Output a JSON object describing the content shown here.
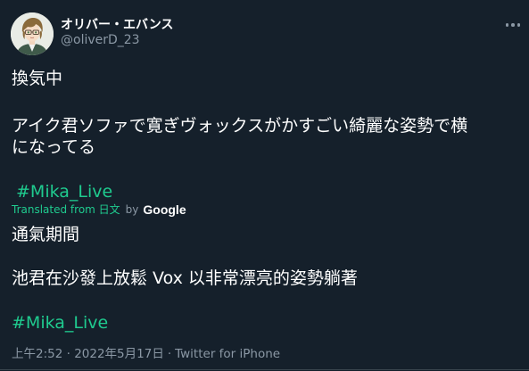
{
  "author": {
    "display_name": "オリバー・エバンス",
    "handle": "@oliverD_23"
  },
  "tweet": {
    "line1": "換気中",
    "line2": "アイク君ソファで寛ぎヴォックスがかすごい綺麗な姿勢で横",
    "line3": "になってる",
    "hashtag": "#Mika_Live"
  },
  "translation": {
    "translated_from": "Translated from 日文",
    "by": "by",
    "provider": "Google",
    "line1": "通氣期間",
    "line2": "池君在沙發上放鬆 Vox 以非常漂亮的姿勢躺著",
    "hashtag": "#Mika_Live"
  },
  "meta": {
    "timestamp": "上午2:52 · 2022年5月17日",
    "separator": "·",
    "source": "Twitter for iPhone"
  },
  "colors": {
    "background": "#15202b",
    "text": "#ffffff",
    "muted": "#8b98a5",
    "accent": "#1fcb8f"
  },
  "icons": {
    "more": "more-horizontal-icon",
    "avatar": "anime-character-avatar"
  }
}
